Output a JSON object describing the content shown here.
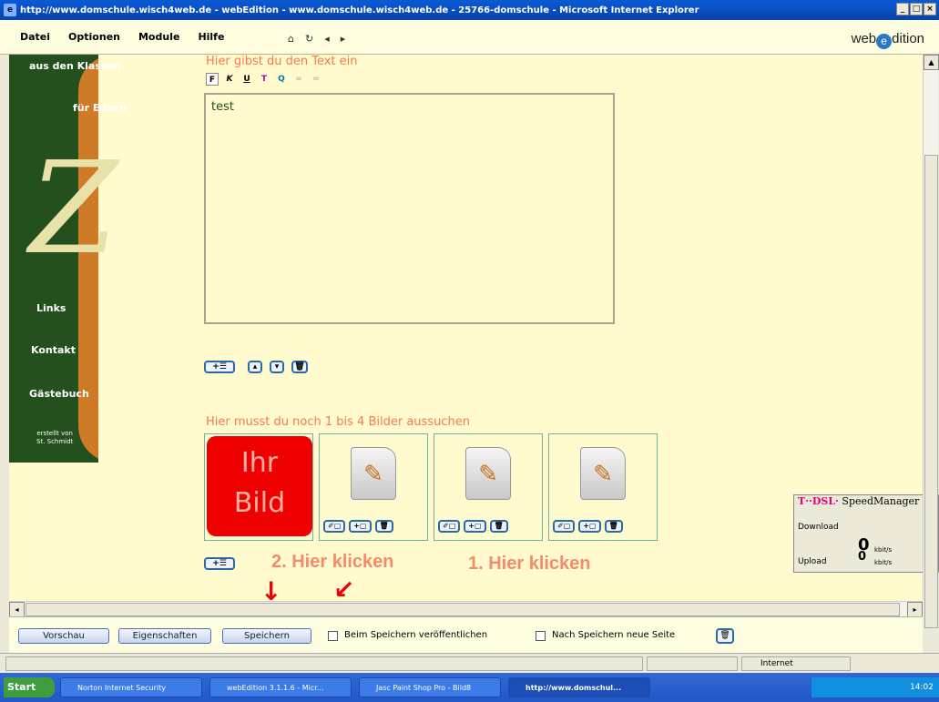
{
  "window": {
    "title": "http://www.domschule.wisch4web.de - webEdition - www.domschule.wisch4web.de - 25766-domschule - Microsoft Internet Explorer",
    "controls": [
      "_",
      "□",
      "×"
    ]
  },
  "menu": {
    "items": [
      "Datei",
      "Optionen",
      "Module",
      "Hilfe"
    ],
    "nav_icons": [
      "home-icon",
      "refresh-icon",
      "back-icon",
      "forward-icon"
    ],
    "nav_glyphs": [
      "⌂",
      "↻",
      "◂",
      "▸"
    ],
    "logo_left": "web",
    "logo_mark": "e",
    "logo_right": "dition"
  },
  "sidebar": {
    "top_link": "aus den Klassen",
    "link_eltern": "für Eltern",
    "links": [
      "Links",
      "Kontakt",
      "Gästebuch"
    ],
    "credit_1": "erstellt von",
    "credit_2": "St. Schmidt"
  },
  "editor": {
    "hint": "Hier gibst du den Text ein",
    "toolbar": [
      "F",
      "K",
      "U",
      "T",
      "Q",
      "∞",
      "∞"
    ],
    "content": "test"
  },
  "images": {
    "hint": "Hier musst du noch 1 bis 4 Bilder aussuchen",
    "placeholder_line1": "Ihr",
    "placeholder_line2": "Bild"
  },
  "annotations": {
    "step2": "2. Hier klicken",
    "step1": "1. Hier klicken"
  },
  "speed_widget": {
    "brand": "T··DSL·",
    "title": "SpeedManager",
    "download_label": "Download",
    "download_value": "0",
    "upload_label": "Upload",
    "upload_value": "0",
    "unit": "kbit/s"
  },
  "bottombar": {
    "preview": "Vorschau",
    "properties": "Eigenschaften",
    "save": "Speichern",
    "publish_on_save": "Beim Speichern veröffentlichen",
    "new_page_after_save": "Nach Speichern neue Seite"
  },
  "status": {
    "zone": "Internet"
  },
  "taskbar": {
    "start": "Start",
    "tasks": [
      "Norton Internet Security",
      "webEdition 3.1.1.6 - Micr...",
      "Jasc Paint Shop Pro - Bild8",
      "http://www.domschul..."
    ],
    "clock": "14:02"
  }
}
